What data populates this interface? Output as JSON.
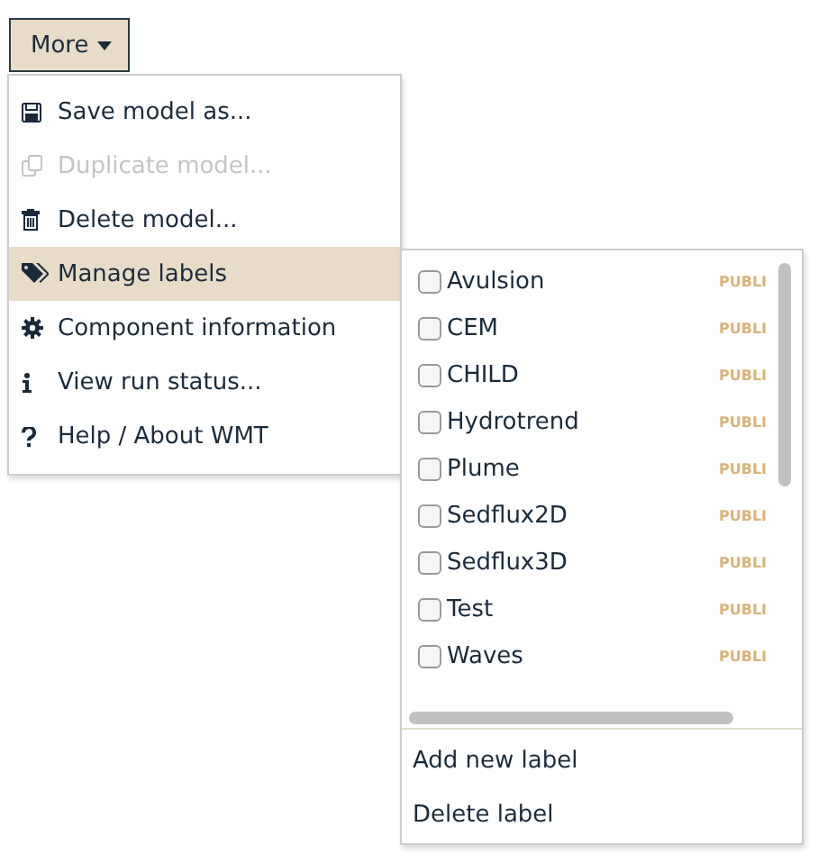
{
  "more_button": {
    "label": "More"
  },
  "menu": {
    "items": [
      {
        "kind": "save",
        "label": "Save model as...",
        "disabled": false,
        "selected": false
      },
      {
        "kind": "copy",
        "label": "Duplicate model...",
        "disabled": true,
        "selected": false
      },
      {
        "kind": "trash",
        "label": "Delete model...",
        "disabled": false,
        "selected": false
      },
      {
        "kind": "tags",
        "label": "Manage labels",
        "disabled": false,
        "selected": true
      },
      {
        "kind": "gear",
        "label": "Component information",
        "disabled": false,
        "selected": false
      },
      {
        "kind": "info",
        "label": "View run status...",
        "disabled": false,
        "selected": false
      },
      {
        "kind": "question",
        "label": "Help / About WMT",
        "disabled": false,
        "selected": false
      }
    ]
  },
  "labels_panel": {
    "labels": [
      {
        "name": "Avulsion",
        "checked": false,
        "visibility": "PUBLI"
      },
      {
        "name": "CEM",
        "checked": false,
        "visibility": "PUBLI"
      },
      {
        "name": "CHILD",
        "checked": false,
        "visibility": "PUBLI"
      },
      {
        "name": "Hydrotrend",
        "checked": false,
        "visibility": "PUBLI"
      },
      {
        "name": "Plume",
        "checked": false,
        "visibility": "PUBLI"
      },
      {
        "name": "Sedflux2D",
        "checked": false,
        "visibility": "PUBLI"
      },
      {
        "name": "Sedflux3D",
        "checked": false,
        "visibility": "PUBLI"
      },
      {
        "name": "Test",
        "checked": false,
        "visibility": "PUBLI"
      },
      {
        "name": "Waves",
        "checked": false,
        "visibility": "PUBLI"
      }
    ],
    "actions": [
      "Add new label",
      "Delete label"
    ]
  }
}
